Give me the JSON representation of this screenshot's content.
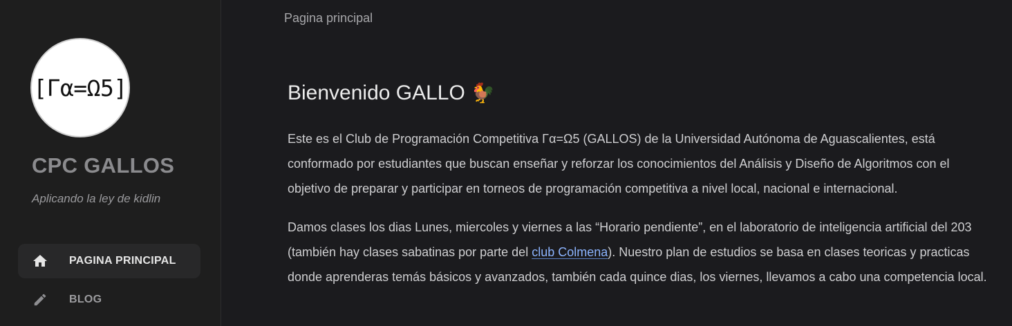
{
  "sidebar": {
    "avatar_text": "[Γα=Ω5]",
    "title": "CPC GALLOS",
    "subtitle": "Aplicando la ley de kidlin",
    "nav": [
      {
        "label": "PAGINA PRINCIPAL",
        "icon": "home-icon",
        "active": true
      },
      {
        "label": "BLOG",
        "icon": "pencil-icon",
        "active": false
      }
    ]
  },
  "breadcrumb": "Pagina principal",
  "main": {
    "title": "Bienvenido GALLO",
    "title_emoji": "🐓",
    "paragraph1": "Este es el Club de Programación Competitiva Γα=Ω5 (GALLOS) de la Universidad Autónoma de Aguascalientes, está conformado por estudiantes que buscan enseñar y reforzar los conocimientos del Análisis y Diseño de Algoritmos con el objetivo de preparar y participar en torneos de programación competitiva a nivel local, nacional e internacional.",
    "paragraph2_before_link": "Damos clases los dias Lunes, miercoles y viernes a las “Horario pendiente”, en el laboratorio de inteligencia artificial del 203 (también hay clases sabatinas por parte del ",
    "paragraph2_link": "club Colmena",
    "paragraph2_after_link": "). Nuestro plan de estudios se basa en clases teoricas y practicas donde aprenderas temás básicos y avanzados, también cada quince dias, los viernes, llevamos a cabo una competencia local."
  },
  "colors": {
    "background": "#1b1b1e",
    "sidebar_background": "#1e1e1e",
    "link": "#8cb4ff"
  }
}
